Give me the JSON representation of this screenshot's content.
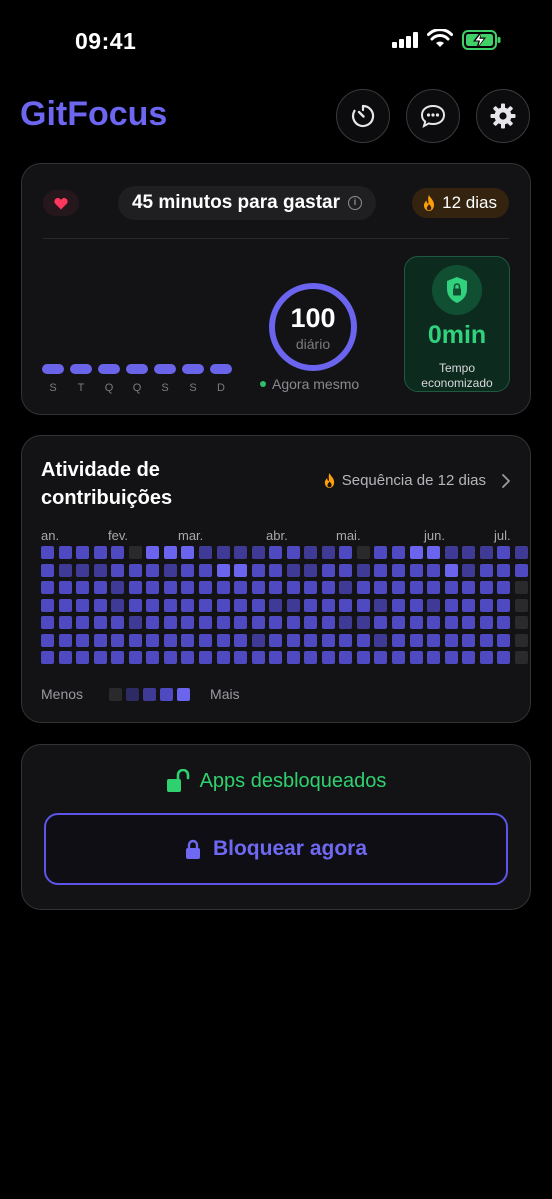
{
  "status_bar": {
    "time": "09:41"
  },
  "header": {
    "app_title": "GitFocus",
    "buttons": [
      {
        "icon": "timer-icon"
      },
      {
        "icon": "chat-icon"
      },
      {
        "icon": "gear-icon"
      }
    ]
  },
  "summary": {
    "minutes_text": "45 minutos para gastar",
    "streak_text": "12 dias",
    "week_days": [
      "S",
      "T",
      "Q",
      "Q",
      "S",
      "S",
      "D"
    ],
    "ring_value": "100",
    "ring_label": "diário",
    "updated_text": "Agora mesmo",
    "saved_value": "0min",
    "saved_caption_1": "Tempo",
    "saved_caption_2": "economizado"
  },
  "activity": {
    "title_line_1": "Atividade de",
    "title_line_2": "contribuições",
    "streak_text": "Sequência de 12 dias",
    "months": [
      "an.",
      "fev.",
      "mar.",
      "abr.",
      "mai.",
      "jun.",
      "jul."
    ],
    "legend_less": "Menos",
    "legend_more": "Mais",
    "levels": [
      "#2a2a2d",
      "#2d2b64",
      "#3e3a96",
      "#4f49c2",
      "#6a64ee"
    ],
    "grid_columns": [
      [
        3,
        3,
        3,
        3,
        3,
        3,
        3
      ],
      [
        3,
        2,
        3,
        3,
        3,
        3,
        3
      ],
      [
        3,
        2,
        3,
        3,
        3,
        3,
        3
      ],
      [
        3,
        2,
        3,
        3,
        3,
        3,
        3
      ],
      [
        3,
        3,
        2,
        2,
        3,
        3,
        3
      ],
      [
        0,
        3,
        3,
        3,
        2,
        3,
        3
      ],
      [
        4,
        3,
        3,
        3,
        3,
        3,
        3
      ],
      [
        4,
        2,
        3,
        3,
        3,
        3,
        3
      ],
      [
        4,
        3,
        3,
        3,
        3,
        3,
        3
      ],
      [
        2,
        3,
        3,
        3,
        3,
        3,
        3
      ],
      [
        2,
        4,
        3,
        3,
        3,
        3,
        3
      ],
      [
        2,
        4,
        3,
        3,
        3,
        3,
        3
      ],
      [
        2,
        3,
        3,
        3,
        3,
        2,
        3
      ],
      [
        3,
        3,
        3,
        2,
        3,
        3,
        3
      ],
      [
        3,
        2,
        3,
        2,
        3,
        3,
        3
      ],
      [
        2,
        2,
        3,
        3,
        3,
        3,
        3
      ],
      [
        2,
        3,
        3,
        3,
        3,
        3,
        3
      ],
      [
        3,
        3,
        2,
        3,
        2,
        3,
        3
      ],
      [
        0,
        2,
        3,
        3,
        2,
        3,
        3
      ],
      [
        3,
        3,
        3,
        2,
        3,
        2,
        3
      ],
      [
        3,
        3,
        3,
        3,
        3,
        3,
        3
      ],
      [
        4,
        3,
        3,
        3,
        3,
        3,
        3
      ],
      [
        4,
        3,
        3,
        2,
        3,
        3,
        3
      ],
      [
        2,
        4,
        3,
        3,
        3,
        3,
        3
      ],
      [
        2,
        2,
        3,
        3,
        3,
        3,
        3
      ],
      [
        2,
        3,
        3,
        3,
        3,
        3,
        3
      ],
      [
        3,
        3,
        3,
        3,
        3,
        3,
        3
      ],
      [
        2,
        3,
        0,
        0,
        0,
        0,
        0
      ]
    ]
  },
  "lock": {
    "status_text": "Apps desbloqueados",
    "button_label": "Bloquear agora"
  }
}
